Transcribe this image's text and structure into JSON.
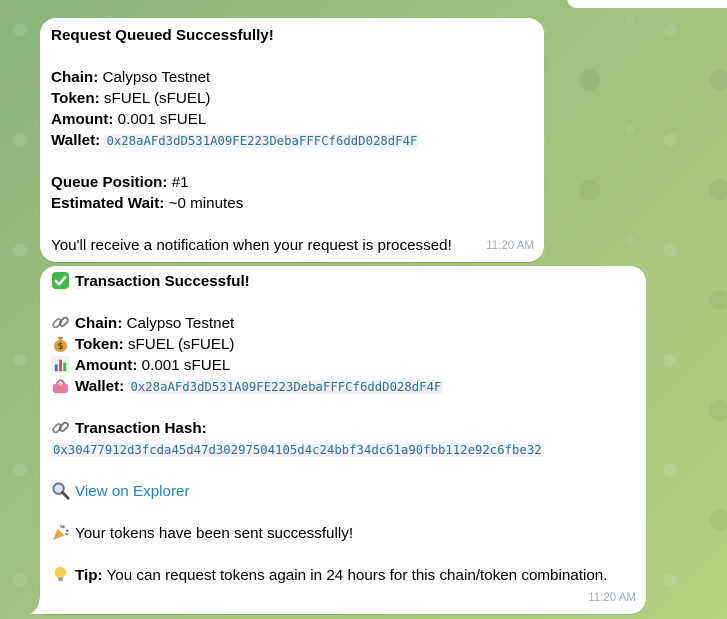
{
  "queued": {
    "title": "Request Queued Successfully!",
    "chain_label": "Chain:",
    "chain_value": "Calypso Testnet",
    "token_label": "Token:",
    "token_value": "sFUEL (sFUEL)",
    "amount_label": "Amount:",
    "amount_value": "0.001 sFUEL",
    "wallet_label": "Wallet:",
    "wallet_value": "0x28aAFd3dD531A09FE223DebaFFFCf6ddD028dF4F",
    "queue_label": "Queue Position:",
    "queue_value": "#1",
    "wait_label": "Estimated Wait:",
    "wait_value": "~0 minutes",
    "notice": "You'll receive a notification when your request is processed!",
    "time": "11:20 AM"
  },
  "success": {
    "title": "Transaction Successful!",
    "chain_label": "Chain:",
    "chain_value": "Calypso Testnet",
    "token_label": "Token:",
    "token_value": "sFUEL (sFUEL)",
    "amount_label": "Amount:",
    "amount_value": "0.001 sFUEL",
    "wallet_label": "Wallet:",
    "wallet_value": "0x28aAFd3dD531A09FE223DebaFFFCf6ddD028dF4F",
    "hash_label": "Transaction Hash:",
    "hash_value": "0x30477912d3fcda45d47d30297504105d4c24bbf34dc61a90fbb112e92c6fbe32",
    "explorer_link": "View on Explorer",
    "sent_text": "Your tokens have been sent successfully!",
    "tip_label": "Tip:",
    "tip_text": "You can request tokens again in 24 hours for this chain/token combination.",
    "time": "11:20 AM"
  },
  "icons": {
    "check": "check-mark-button-icon",
    "chain": "link-icon",
    "token": "money-bag-icon",
    "amount": "bar-chart-icon",
    "wallet": "purse-icon",
    "hash": "link-icon",
    "explorer": "magnifying-glass-icon",
    "sent": "party-popper-icon",
    "tip": "light-bulb-icon"
  },
  "colors": {
    "background": "#9cc07f",
    "bubble": "#ffffff",
    "link": "#2481cc",
    "code": "#2f6f9f",
    "timestamp": "#a0acb6"
  }
}
